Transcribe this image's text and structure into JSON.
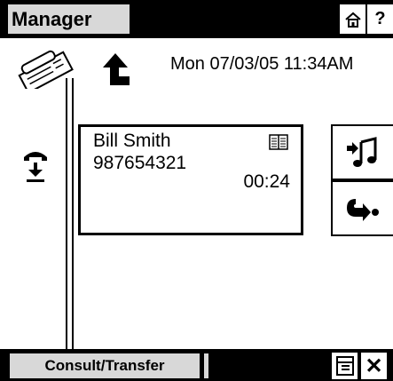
{
  "header": {
    "title": "Manager",
    "home_icon": "home-icon",
    "help_label": "?"
  },
  "status": {
    "datetime": "Mon 07/03/05 11:34AM"
  },
  "call": {
    "name": "Bill Smith",
    "number": "987654321",
    "duration": "00:24"
  },
  "side_buttons": {
    "music_icon": "music-on-hold-icon",
    "hold_icon": "hold-transfer-icon"
  },
  "footer": {
    "consult_label": "Consult/Transfer",
    "close_label": "✕"
  }
}
